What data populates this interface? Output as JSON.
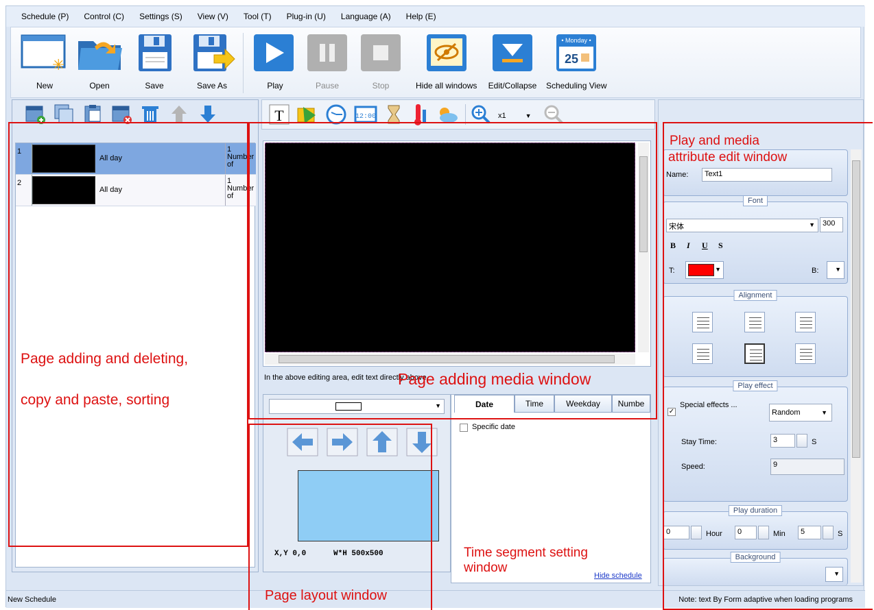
{
  "menu": [
    "Schedule (P)",
    "Control (C)",
    "Settings (S)",
    "View (V)",
    "Tool (T)",
    "Plug-in (U)",
    "Language (A)",
    "Help (E)"
  ],
  "ribbon": {
    "new": "New",
    "open": "Open",
    "save": "Save",
    "save_as": "Save As",
    "play": "Play",
    "pause": "Pause",
    "stop": "Stop",
    "hide_all": "Hide all windows",
    "edit_collapse": "Edit/Collapse",
    "scheduling_view": "Scheduling View",
    "calendar_weekday": "• Monday •",
    "calendar_day": "25"
  },
  "pages": [
    {
      "index": "1",
      "time": "All day",
      "info": "1 Number of"
    },
    {
      "index": "2",
      "time": "All day",
      "info": "1 Number of"
    }
  ],
  "center": {
    "zoom": "x1",
    "hint": "In the above editing area, edit text directly above",
    "coords_label": "X,Y 0,0",
    "size_label": "W*H 500x500",
    "tabs": [
      "Date",
      "Time",
      "Weekday",
      "Numbe"
    ],
    "specific_date": "Specific date",
    "hide_schedule": "Hide schedule"
  },
  "props": {
    "name_label": "Name:",
    "name_value": "Text1",
    "font_group": "Font",
    "font_name": "宋体",
    "font_size": "300",
    "bold": "B",
    "italic": "I",
    "underline": "U",
    "strike": "S",
    "text_color_label": "T:",
    "back_color_label": "B:",
    "text_color": "#ff0000",
    "alignment_group": "Alignment",
    "play_effect_group": "Play effect",
    "special_effects_label": "Special effects ...",
    "special_effects_value": "Random",
    "stay_time_label": "Stay Time:",
    "stay_time_value": "3",
    "stay_unit": "S",
    "speed_label": "Speed:",
    "speed_value": "9",
    "duration_group": "Play duration",
    "hour_value": "0",
    "hour_label": "Hour",
    "min_value": "0",
    "min_label": "Min",
    "sec_value": "5",
    "sec_label": "S",
    "background_group": "Background"
  },
  "status": {
    "left": "New Schedule",
    "right": "Note: text By Form adaptive when loading programs"
  },
  "annotations": {
    "page_adding_1": "Page adding and deleting,",
    "page_adding_2": "copy and paste, sorting",
    "media_window": "Page adding media window",
    "attr_window_1": "Play and media",
    "attr_window_2": "attribute edit window",
    "time_segment_1": "Time segment setting",
    "time_segment_2": "window",
    "layout_window": "Page layout window"
  }
}
